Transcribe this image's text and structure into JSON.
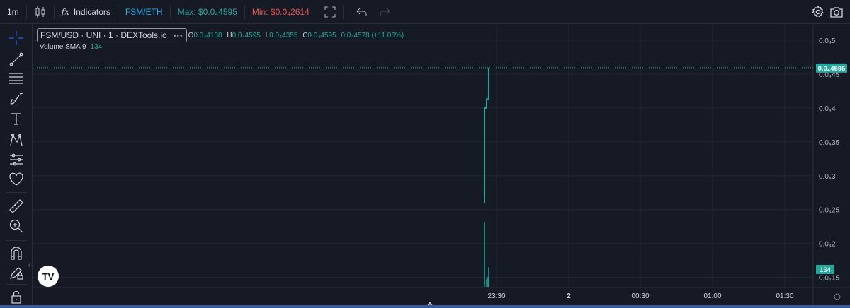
{
  "toolbar": {
    "interval": "1m",
    "indicators_label": "Indicators",
    "pair": "FSM/ETH",
    "max_label": "Max: $0.0₄4595",
    "min_label": "Min: $0.0₄2614"
  },
  "legend": {
    "symbol_title": "FSM/USD · UNI · 1 · DEXTools.io",
    "dots": "•••",
    "open_label": "O",
    "open_value": "0.0₄4138",
    "high_label": "H",
    "high_value": "0.0₄4595",
    "low_label": "L",
    "low_value": "0.0₄4355",
    "close_label": "C",
    "close_value": "0.0₄4595",
    "change": "0.0₄4578 (+11.06%)",
    "volume_label": "Volume SMA 9",
    "volume_value": "134"
  },
  "logo_text": "TV",
  "colors": {
    "background": "#161a25",
    "up": "#26a69a",
    "down": "#ef5350",
    "pair": "#2aa8e8",
    "grid": "#232733",
    "text": "#b2b5be"
  },
  "chart_data": {
    "type": "line",
    "title": "FSM/USD · UNI · 1 · DEXTools.io",
    "xlabel": "",
    "ylabel": "",
    "y_tick_labels": [
      "0.0₄5",
      "0.0₄45",
      "0.0₄4",
      "0.0₄35",
      "0.0₄3",
      "0.0₄25",
      "0.0₄2",
      "0.0₄15"
    ],
    "y_tick_values": [
      5e-06,
      4.5e-06,
      4e-06,
      3.5e-06,
      3e-06,
      2.5e-06,
      2e-06,
      1.5e-06
    ],
    "ylim": [
      1.35e-06,
      5.24e-06
    ],
    "x_tick_labels": [
      "23:30",
      "2",
      "00:30",
      "01:00",
      "01:30"
    ],
    "x_tick_bold": [
      false,
      true,
      false,
      false,
      false
    ],
    "last_price_label": "0.0₄4595",
    "last_price_value": 4.595e-06,
    "volume_badge": "134",
    "grid": true,
    "series": [
      {
        "name": "",
        "points": [
          {
            "time": "23:28",
            "value": 2.6e-06
          },
          {
            "time": "23:28",
            "value": 4e-06
          },
          {
            "time": "23:29",
            "value": 4e-06
          },
          {
            "time": "23:29",
            "value": 4.13e-06
          },
          {
            "time": "23:30",
            "value": 4.13e-06
          },
          {
            "time": "23:30",
            "value": 4.595e-06
          }
        ]
      }
    ],
    "volume_bars": [
      {
        "time": "23:28",
        "value": 100
      },
      {
        "time": "23:29",
        "value": 12
      },
      {
        "time": "23:29",
        "value": 15
      },
      {
        "time": "23:30",
        "value": 30
      }
    ]
  }
}
